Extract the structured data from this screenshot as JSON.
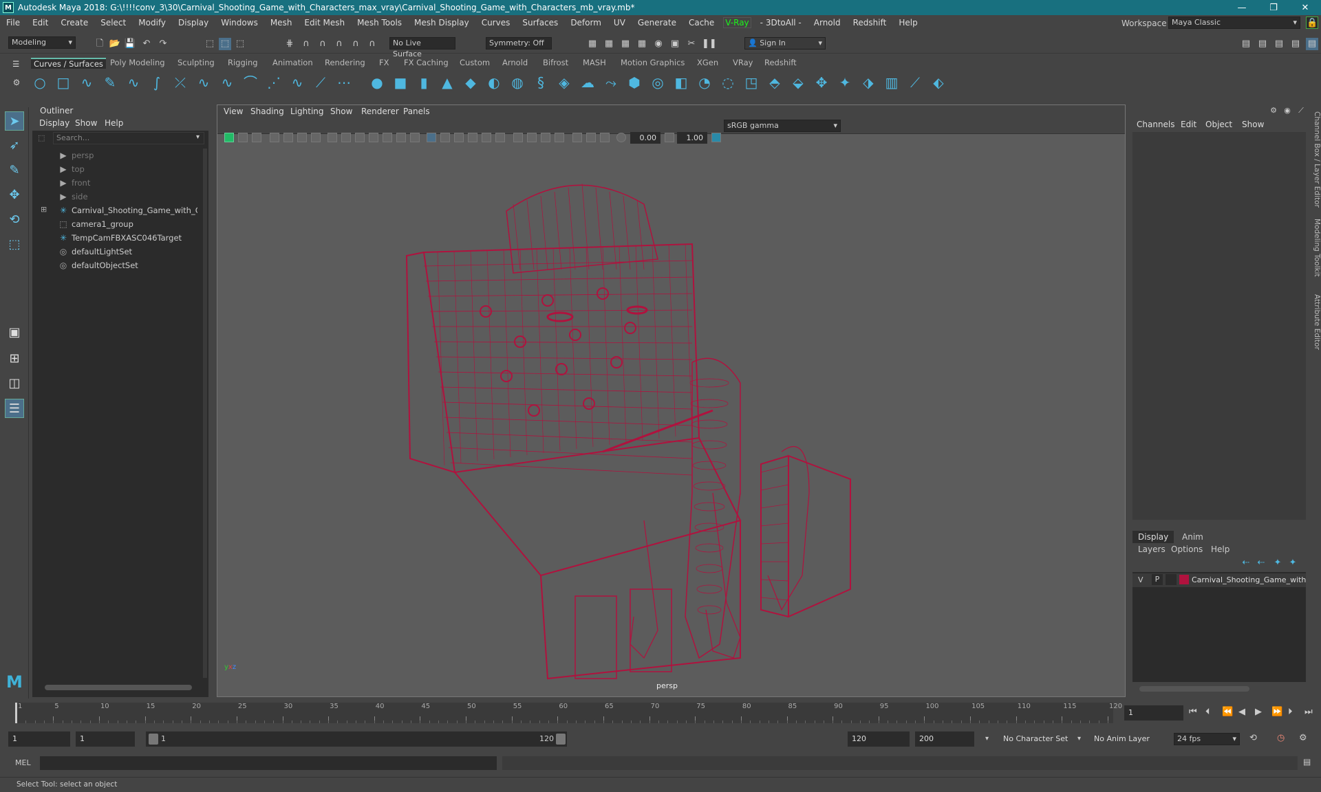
{
  "window": {
    "title": "Autodesk Maya 2018: G:\\!!!!conv_3\\30\\Carnival_Shooting_Game_with_Characters_max_vray\\Carnival_Shooting_Game_with_Characters_mb_vray.mb*",
    "logo": "M",
    "minimize": "—",
    "maximize": "❐",
    "close": "✕"
  },
  "menubar": {
    "items": [
      "File",
      "Edit",
      "Create",
      "Select",
      "Modify",
      "Display",
      "Windows",
      "Mesh",
      "Edit Mesh",
      "Mesh Tools",
      "Mesh Display",
      "Curves",
      "Surfaces",
      "Deform",
      "UV",
      "Generate",
      "Cache",
      "V-Ray",
      "- 3DtoAll -",
      "Arnold",
      "Redshift",
      "Help"
    ],
    "workspace_label": "Workspace :",
    "workspace_value": "Maya Classic"
  },
  "statusline": {
    "mode": "Modeling",
    "live_surface": "No Live Surface",
    "symmetry": "Symmetry: Off",
    "sign_in": "Sign In"
  },
  "shelf": {
    "tabs": [
      "Curves / Surfaces",
      "Poly Modeling",
      "Sculpting",
      "Rigging",
      "Animation",
      "Rendering",
      "FX",
      "FX Caching",
      "Custom",
      "Arnold",
      "Bifrost",
      "MASH",
      "Motion Graphics",
      "XGen",
      "VRay",
      "Redshift"
    ],
    "active_tab": "Curves / Surfaces"
  },
  "outliner": {
    "title": "Outliner",
    "menu": [
      "Display",
      "Show",
      "Help"
    ],
    "search_placeholder": "Search...",
    "items": [
      {
        "label": "persp",
        "icon": "camera-icon",
        "dim": true
      },
      {
        "label": "top",
        "icon": "camera-icon",
        "dim": true
      },
      {
        "label": "front",
        "icon": "camera-icon",
        "dim": true
      },
      {
        "label": "side",
        "icon": "camera-icon",
        "dim": true
      },
      {
        "label": "Carnival_Shooting_Game_with_Chara",
        "icon": "group-icon",
        "dim": false,
        "expandable": true
      },
      {
        "label": "camera1_group",
        "icon": "group-icon",
        "dim": false
      },
      {
        "label": "TempCamFBXASC046Target",
        "icon": "locator-icon",
        "dim": false
      },
      {
        "label": "defaultLightSet",
        "icon": "set-icon",
        "dim": false
      },
      {
        "label": "defaultObjectSet",
        "icon": "set-icon",
        "dim": false
      }
    ]
  },
  "viewport": {
    "menu": [
      "View",
      "Shading",
      "Lighting",
      "Show",
      "Renderer",
      "Panels"
    ],
    "near": "0.00",
    "far": "1.00",
    "color_space": "sRGB gamma",
    "camera_label": "persp",
    "wire_color": "#b0123e"
  },
  "channelbox": {
    "menu": [
      "Channels",
      "Edit",
      "Object",
      "Show"
    ]
  },
  "layers": {
    "tabs": [
      "Display",
      "Anim"
    ],
    "active_tab": "Display",
    "menu": [
      "Layers",
      "Options",
      "Help"
    ],
    "row": {
      "v": "V",
      "p": "P",
      "name": "Carnival_Shooting_Game_with",
      "color": "#b0123e"
    }
  },
  "sidetabs": [
    "Channel Box / Layer Editor",
    "Modeling Toolkit",
    "Attribute Editor"
  ],
  "timeline": {
    "ticks": [
      "1",
      "5",
      "10",
      "15",
      "20",
      "25",
      "30",
      "35",
      "40",
      "45",
      "50",
      "55",
      "60",
      "65",
      "70",
      "75",
      "80",
      "85",
      "90",
      "95",
      "100",
      "105",
      "110",
      "115",
      "120"
    ],
    "current_frame": "1"
  },
  "range": {
    "start": "1",
    "inner_start": "1",
    "slider_start": "1",
    "slider_end": "120",
    "end": "120",
    "anim_end": "200",
    "character_set": "No Character Set",
    "anim_layer": "No Anim Layer",
    "fps": "24 fps"
  },
  "command": {
    "label": "MEL"
  },
  "help": {
    "text": "Select Tool: select an object"
  }
}
